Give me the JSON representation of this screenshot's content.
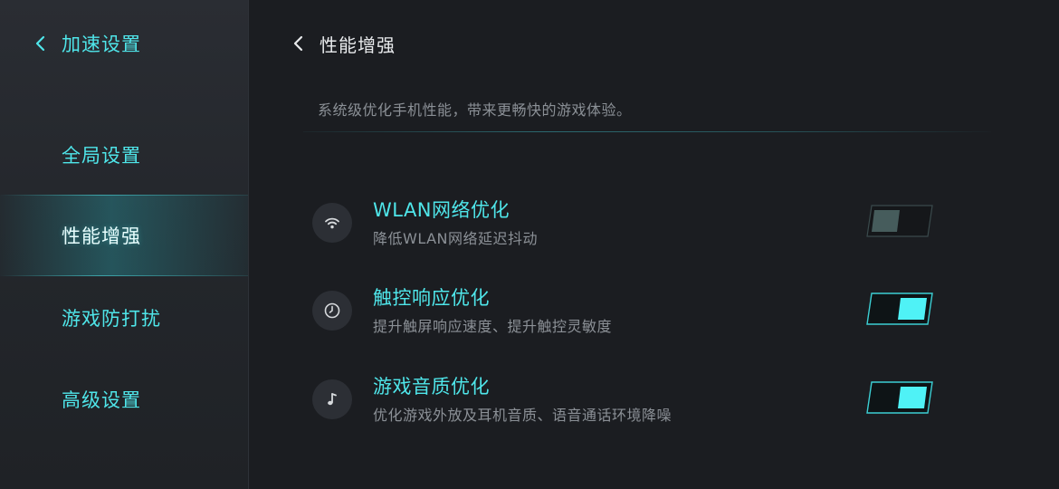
{
  "sidebar": {
    "title": "加速设置",
    "items": [
      {
        "label": "全局设置",
        "active": false
      },
      {
        "label": "性能增强",
        "active": true
      },
      {
        "label": "游戏防打扰",
        "active": false
      },
      {
        "label": "高级设置",
        "active": false
      }
    ]
  },
  "main": {
    "title": "性能增强",
    "description": "系统级优化手机性能，带来更畅快的游戏体验。",
    "settings": [
      {
        "icon": "wifi-icon",
        "title": "WLAN网络优化",
        "subtitle": "降低WLAN网络延迟抖动",
        "enabled": false
      },
      {
        "icon": "clock-icon",
        "title": "触控响应优化",
        "subtitle": "提升触屏响应速度、提升触控灵敏度",
        "enabled": true
      },
      {
        "icon": "music-note-icon",
        "title": "游戏音质优化",
        "subtitle": "优化游戏外放及耳机音质、语音通话环境降噪",
        "enabled": true
      }
    ]
  },
  "colors": {
    "accent": "#4fe6ea",
    "background": "#1b1d21",
    "sidebar": "#26292e",
    "text_primary": "#e8eaec",
    "text_secondary": "#8b9096"
  }
}
